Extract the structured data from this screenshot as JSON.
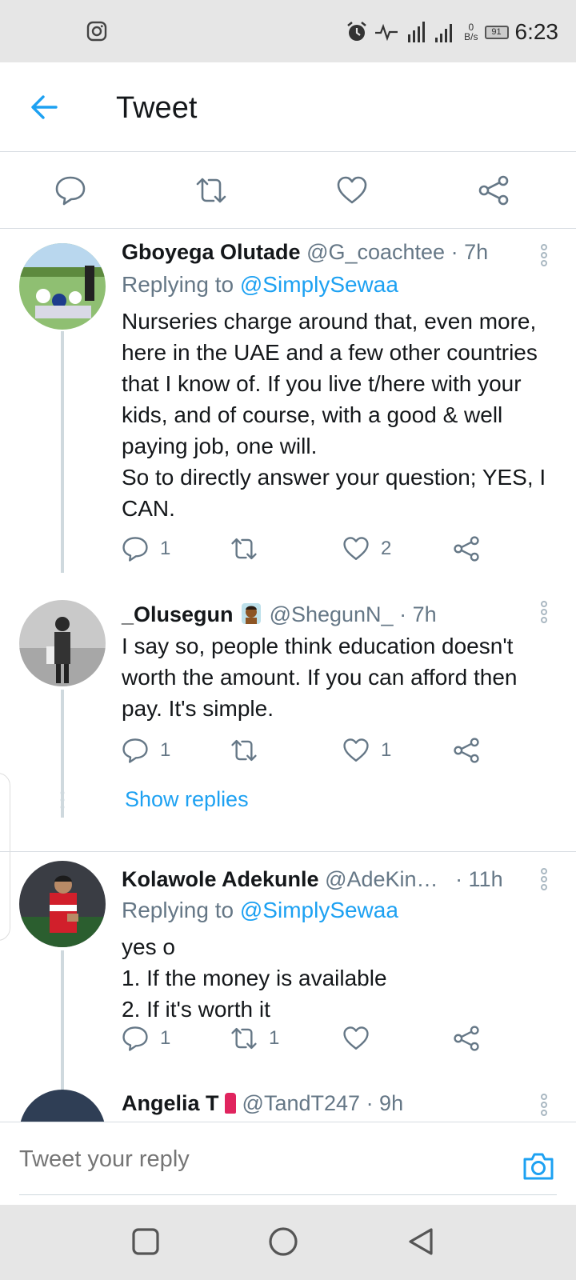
{
  "status_bar": {
    "time": "6:23",
    "battery": "91",
    "net_speed_value": "0",
    "net_speed_unit": "B/s",
    "icons": [
      "instagram-icon",
      "alarm-icon",
      "activity-icon",
      "signal-icon",
      "battery-icon"
    ]
  },
  "header": {
    "title": "Tweet"
  },
  "tweets": [
    {
      "name": "Gboyega Olutade",
      "handle": "@G_coachtee",
      "time": "· 7h",
      "replying_prefix": "Replying to ",
      "replying_to": "@SimplySewaa",
      "text": "Nurseries charge around that, even more, here in the UAE and a few other countries that I know of. If you live t/here with your kids, and of course, with a good & well paying job, one will.\nSo to directly answer your question; YES, I CAN.",
      "replies": "1",
      "retweets": "",
      "likes": "2"
    },
    {
      "name": "_Olusegun",
      "handle": "@ShegunN_",
      "time": "· 7h",
      "text": "I say so, people think education doesn't worth the amount. If you can afford then pay. It's simple.",
      "replies": "1",
      "retweets": "",
      "likes": "1",
      "show_replies": "Show replies"
    },
    {
      "name": "Kolawole Adekunle",
      "handle": "@AdeKin…",
      "time": "· 11h",
      "replying_prefix": "Replying to ",
      "replying_to": "@SimplySewaa",
      "text": "yes o\n1. If the money is available\n2. If it's worth it",
      "replies": "1",
      "retweets": "1",
      "likes": ""
    },
    {
      "name": "Angelia T",
      "handle": "@TandT247",
      "time": "· 9h"
    }
  ],
  "reply_bar": {
    "placeholder": "Tweet your reply"
  },
  "colors": {
    "accent": "#1da1f2",
    "secondary_text": "#657786",
    "divider": "#d8dde2"
  }
}
